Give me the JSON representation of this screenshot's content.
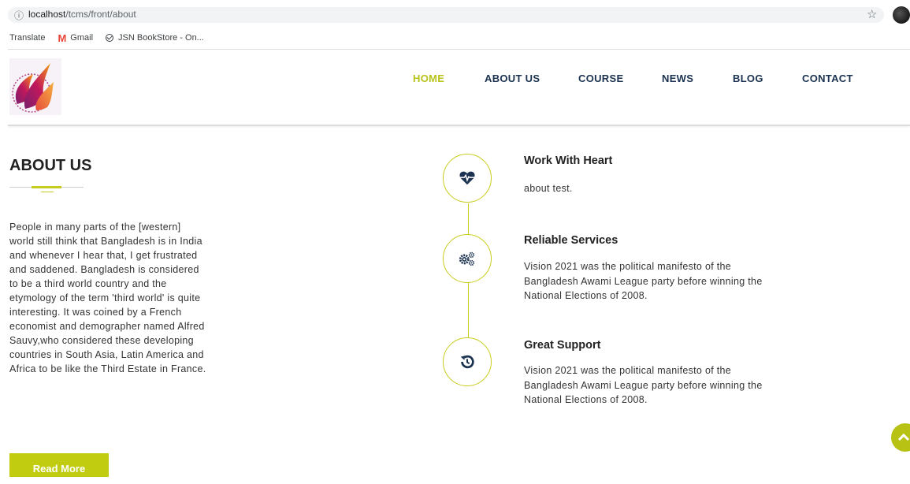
{
  "browser": {
    "url_host": "localhost",
    "url_path": "/tcms/front/about",
    "bookmarks": [
      {
        "label": "Translate",
        "icon": ""
      },
      {
        "label": "Gmail",
        "icon": "gmail-icon"
      },
      {
        "label": "JSN BookStore - On...",
        "icon": "check-circle-icon"
      }
    ]
  },
  "nav": {
    "items": [
      {
        "label": "HOME",
        "active": true
      },
      {
        "label": "ABOUT US",
        "active": false
      },
      {
        "label": "COURSE",
        "active": false
      },
      {
        "label": "NEWS",
        "active": false
      },
      {
        "label": "BLOG",
        "active": false
      },
      {
        "label": "CONTACT",
        "active": false
      }
    ]
  },
  "about": {
    "title": "ABOUT US",
    "body": "People in many parts of the [western] world still think that Bangladesh is in India and whenever I hear that, I get frustrated and saddened. Bangladesh is considered to be a third world country and the etymology of the term 'third world' is quite interesting. It was coined by a French economist and demographer named Alfred Sauvy,who considered these developing countries in South Asia, Latin America and Africa to be like the Third Estate in France.",
    "read_more": "Read More"
  },
  "features": [
    {
      "title": "Work With Heart",
      "text": "about test.",
      "icon": "heartbeat-icon"
    },
    {
      "title": "Reliable Services",
      "text": "Vision 2021 was the political manifesto of the Bangladesh Awami League party before winning the National Elections of 2008.",
      "icon": "cogs-icon"
    },
    {
      "title": "Great Support",
      "text": "Vision 2021 was the political manifesto of the Bangladesh Awami League party before winning the National Elections of 2008.",
      "icon": "history-icon"
    }
  ],
  "colors": {
    "accent": "#c8cc1c",
    "nav_text": "#1b3250",
    "button": "#c1cc10"
  }
}
